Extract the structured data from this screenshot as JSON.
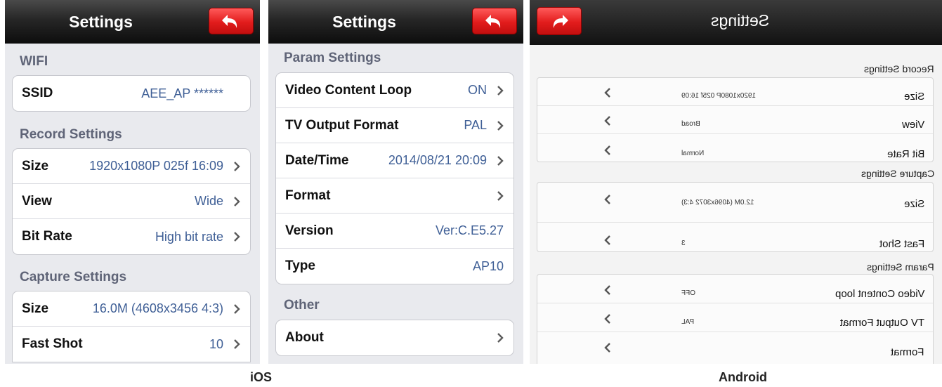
{
  "ios": {
    "nav_title": "Settings",
    "screen1": {
      "sections": [
        {
          "title": "WIFI",
          "rows": [
            {
              "label": "SSID",
              "value": "AEE_AP ******",
              "chevron": false
            }
          ]
        },
        {
          "title": "Record Settings",
          "rows": [
            {
              "label": "Size",
              "value": "1920x1080P 025f 16:09",
              "chevron": true
            },
            {
              "label": "View",
              "value": "Wide",
              "chevron": true
            },
            {
              "label": "Bit Rate",
              "value": "High bit rate",
              "chevron": true
            }
          ]
        },
        {
          "title": "Capture Settings",
          "rows": [
            {
              "label": "Size",
              "value": "16.0M (4608x3456 4:3)",
              "chevron": true
            },
            {
              "label": "Fast Shot",
              "value": "10",
              "chevron": true
            }
          ]
        }
      ]
    },
    "screen2": {
      "sections": [
        {
          "title": "Param Settings",
          "rows": [
            {
              "label": "Video Content Loop",
              "value": "ON",
              "chevron": true
            },
            {
              "label": "TV Output Format",
              "value": "PAL",
              "chevron": true
            },
            {
              "label": "Date/Time",
              "value": "2014/08/21 20:09",
              "chevron": true
            },
            {
              "label": "Format",
              "value": "",
              "chevron": true
            },
            {
              "label": "Version",
              "value": "Ver:C.E5.27",
              "chevron": false
            },
            {
              "label": "Type",
              "value": "AP10",
              "chevron": false
            }
          ]
        },
        {
          "title": "Other",
          "rows": [
            {
              "label": "About",
              "value": "",
              "chevron": true
            }
          ]
        }
      ]
    }
  },
  "android": {
    "title": "Settings",
    "sections": [
      {
        "title": "Record Settings",
        "rows": [
          {
            "label": "Size",
            "value": "1920x1080P 025f 16:09"
          },
          {
            "label": "View",
            "value": "Broad"
          },
          {
            "label": "Bit Rate",
            "value": "Normal"
          }
        ]
      },
      {
        "title": "Capture Settings",
        "rows": [
          {
            "label": "Size",
            "value": "12.0M (4096x3072 4:3)"
          },
          {
            "label": "Fast Shot",
            "value": "3"
          }
        ]
      },
      {
        "title": "Param Settings",
        "rows": [
          {
            "label": "Video Content loop",
            "value": "OFF"
          },
          {
            "label": "TV Output Format",
            "value": "PAL"
          },
          {
            "label": "Format",
            "value": ""
          }
        ]
      }
    ]
  },
  "captions": {
    "ios": "iOS",
    "android": "Android"
  },
  "colors": {
    "accent_red": "#e21c1c",
    "ios_value_blue": "#3f5f96",
    "ios_background": "#e9eaee"
  },
  "icons": {
    "back": "curved-back-arrow-icon",
    "forward": "curved-forward-arrow-icon",
    "chevron_right": "chevron-right-icon",
    "chevron_left": "chevron-left-icon"
  }
}
